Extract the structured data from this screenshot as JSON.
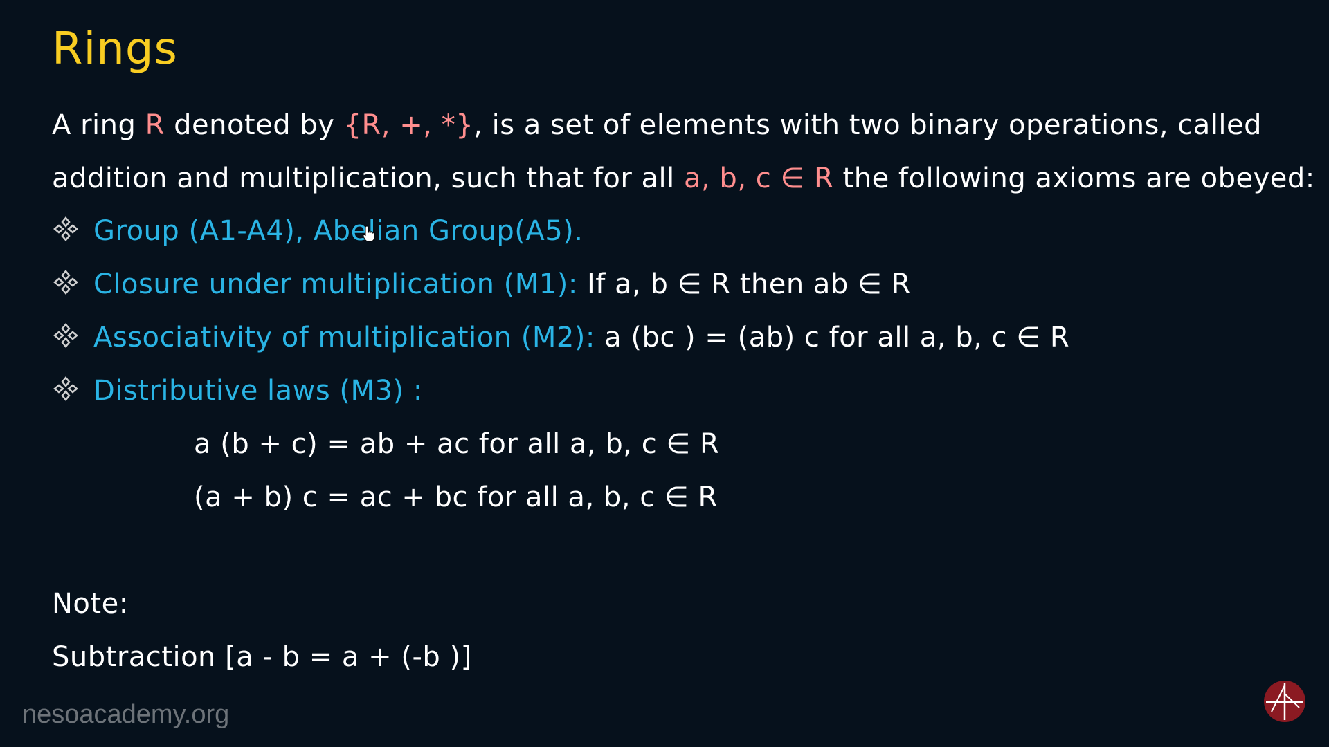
{
  "title": "Rings",
  "intro": {
    "line1": {
      "p1": "A ring ",
      "p2": "R",
      "p3": " denoted by ",
      "p4": "{R, +, *}",
      "p5": ", is a set of elements with two binary operations, called"
    },
    "line2": {
      "p1": "addition and multiplication,  such that for all ",
      "p2": "a, b, c ∈ R",
      "p3": "  the following axioms are obeyed:"
    }
  },
  "bullets": [
    {
      "icon": "four-diamond-bullet-icon",
      "label": "Group (A1-A4), Abelian Group(A5).",
      "text": ""
    },
    {
      "icon": "four-diamond-bullet-icon",
      "label": "Closure under multiplication (M1):",
      "text": " If a, b ∈ R then ab ∈ R"
    },
    {
      "icon": "four-diamond-bullet-icon",
      "label": "Associativity of multiplication (M2):",
      "text": " a (bc ) = (ab) c for all a, b, c ∈ R"
    },
    {
      "icon": "four-diamond-bullet-icon",
      "label": "Distributive laws (M3) :",
      "text": ""
    }
  ],
  "distributive": {
    "left": "a (b + c) = ab + ac  for all a, b, c ∈ R",
    "right": "(a + b) c = ac + bc  for all a, b, c ∈ R"
  },
  "note": {
    "label": "Note:",
    "text": "Subtraction [a - b = a +  (-b )]"
  },
  "watermark": "nesoacademy.org",
  "logo_icon": "neso-academy-logo-icon",
  "cursor_icon": "hand-pointer-cursor-icon",
  "colors": {
    "background": "#06111c",
    "title": "#f8cd22",
    "highlight_pink": "#ff8e8e",
    "highlight_cyan": "#2ab4e5",
    "text": "#ffffff",
    "watermark": "#6d7379",
    "logo": "#8b1a22"
  }
}
